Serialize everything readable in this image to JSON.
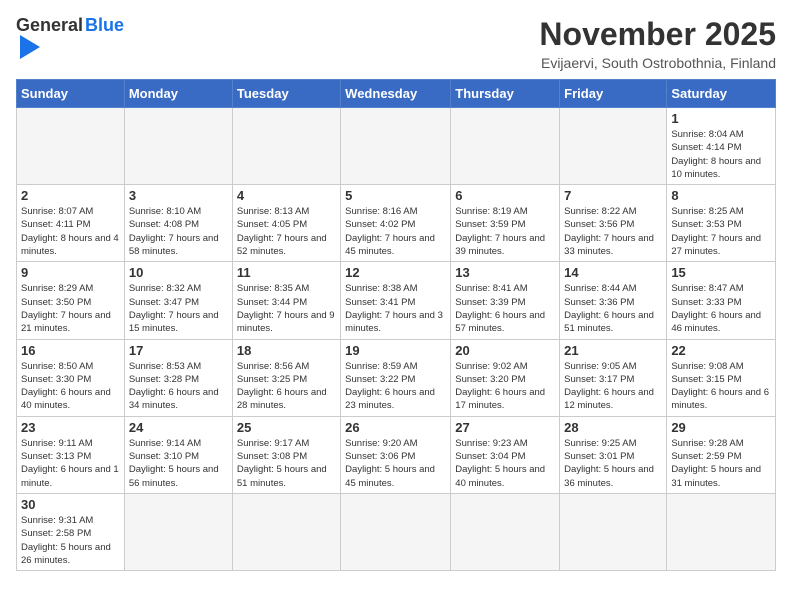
{
  "header": {
    "logo_general": "General",
    "logo_blue": "Blue",
    "month": "November 2025",
    "location": "Evijaervi, South Ostrobothnia, Finland"
  },
  "weekdays": [
    "Sunday",
    "Monday",
    "Tuesday",
    "Wednesday",
    "Thursday",
    "Friday",
    "Saturday"
  ],
  "weeks": [
    [
      {
        "day": "",
        "info": ""
      },
      {
        "day": "",
        "info": ""
      },
      {
        "day": "",
        "info": ""
      },
      {
        "day": "",
        "info": ""
      },
      {
        "day": "",
        "info": ""
      },
      {
        "day": "",
        "info": ""
      },
      {
        "day": "1",
        "info": "Sunrise: 8:04 AM\nSunset: 4:14 PM\nDaylight: 8 hours\nand 10 minutes."
      }
    ],
    [
      {
        "day": "2",
        "info": "Sunrise: 8:07 AM\nSunset: 4:11 PM\nDaylight: 8 hours\nand 4 minutes."
      },
      {
        "day": "3",
        "info": "Sunrise: 8:10 AM\nSunset: 4:08 PM\nDaylight: 7 hours\nand 58 minutes."
      },
      {
        "day": "4",
        "info": "Sunrise: 8:13 AM\nSunset: 4:05 PM\nDaylight: 7 hours\nand 52 minutes."
      },
      {
        "day": "5",
        "info": "Sunrise: 8:16 AM\nSunset: 4:02 PM\nDaylight: 7 hours\nand 45 minutes."
      },
      {
        "day": "6",
        "info": "Sunrise: 8:19 AM\nSunset: 3:59 PM\nDaylight: 7 hours\nand 39 minutes."
      },
      {
        "day": "7",
        "info": "Sunrise: 8:22 AM\nSunset: 3:56 PM\nDaylight: 7 hours\nand 33 minutes."
      },
      {
        "day": "8",
        "info": "Sunrise: 8:25 AM\nSunset: 3:53 PM\nDaylight: 7 hours\nand 27 minutes."
      }
    ],
    [
      {
        "day": "9",
        "info": "Sunrise: 8:29 AM\nSunset: 3:50 PM\nDaylight: 7 hours\nand 21 minutes."
      },
      {
        "day": "10",
        "info": "Sunrise: 8:32 AM\nSunset: 3:47 PM\nDaylight: 7 hours\nand 15 minutes."
      },
      {
        "day": "11",
        "info": "Sunrise: 8:35 AM\nSunset: 3:44 PM\nDaylight: 7 hours\nand 9 minutes."
      },
      {
        "day": "12",
        "info": "Sunrise: 8:38 AM\nSunset: 3:41 PM\nDaylight: 7 hours\nand 3 minutes."
      },
      {
        "day": "13",
        "info": "Sunrise: 8:41 AM\nSunset: 3:39 PM\nDaylight: 6 hours\nand 57 minutes."
      },
      {
        "day": "14",
        "info": "Sunrise: 8:44 AM\nSunset: 3:36 PM\nDaylight: 6 hours\nand 51 minutes."
      },
      {
        "day": "15",
        "info": "Sunrise: 8:47 AM\nSunset: 3:33 PM\nDaylight: 6 hours\nand 46 minutes."
      }
    ],
    [
      {
        "day": "16",
        "info": "Sunrise: 8:50 AM\nSunset: 3:30 PM\nDaylight: 6 hours\nand 40 minutes."
      },
      {
        "day": "17",
        "info": "Sunrise: 8:53 AM\nSunset: 3:28 PM\nDaylight: 6 hours\nand 34 minutes."
      },
      {
        "day": "18",
        "info": "Sunrise: 8:56 AM\nSunset: 3:25 PM\nDaylight: 6 hours\nand 28 minutes."
      },
      {
        "day": "19",
        "info": "Sunrise: 8:59 AM\nSunset: 3:22 PM\nDaylight: 6 hours\nand 23 minutes."
      },
      {
        "day": "20",
        "info": "Sunrise: 9:02 AM\nSunset: 3:20 PM\nDaylight: 6 hours\nand 17 minutes."
      },
      {
        "day": "21",
        "info": "Sunrise: 9:05 AM\nSunset: 3:17 PM\nDaylight: 6 hours\nand 12 minutes."
      },
      {
        "day": "22",
        "info": "Sunrise: 9:08 AM\nSunset: 3:15 PM\nDaylight: 6 hours\nand 6 minutes."
      }
    ],
    [
      {
        "day": "23",
        "info": "Sunrise: 9:11 AM\nSunset: 3:13 PM\nDaylight: 6 hours\nand 1 minute."
      },
      {
        "day": "24",
        "info": "Sunrise: 9:14 AM\nSunset: 3:10 PM\nDaylight: 5 hours\nand 56 minutes."
      },
      {
        "day": "25",
        "info": "Sunrise: 9:17 AM\nSunset: 3:08 PM\nDaylight: 5 hours\nand 51 minutes."
      },
      {
        "day": "26",
        "info": "Sunrise: 9:20 AM\nSunset: 3:06 PM\nDaylight: 5 hours\nand 45 minutes."
      },
      {
        "day": "27",
        "info": "Sunrise: 9:23 AM\nSunset: 3:04 PM\nDaylight: 5 hours\nand 40 minutes."
      },
      {
        "day": "28",
        "info": "Sunrise: 9:25 AM\nSunset: 3:01 PM\nDaylight: 5 hours\nand 36 minutes."
      },
      {
        "day": "29",
        "info": "Sunrise: 9:28 AM\nSunset: 2:59 PM\nDaylight: 5 hours\nand 31 minutes."
      }
    ],
    [
      {
        "day": "30",
        "info": "Sunrise: 9:31 AM\nSunset: 2:58 PM\nDaylight: 5 hours\nand 26 minutes."
      },
      {
        "day": "",
        "info": ""
      },
      {
        "day": "",
        "info": ""
      },
      {
        "day": "",
        "info": ""
      },
      {
        "day": "",
        "info": ""
      },
      {
        "day": "",
        "info": ""
      },
      {
        "day": "",
        "info": ""
      }
    ]
  ]
}
